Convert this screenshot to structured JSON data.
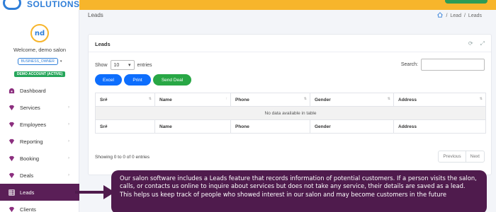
{
  "brand": {
    "name": "SOLUTIONS",
    "logo_mark": "nd"
  },
  "profile": {
    "welcome": "Welcome, demo salon",
    "role": "BUSINESS_OWNER",
    "status": "DEMO ACCOUNT (ACTIVE)"
  },
  "sidebar": {
    "items": [
      {
        "label": "Dashboard",
        "icon": "dashboard-icon"
      },
      {
        "label": "Services",
        "icon": "gem-icon",
        "caret": "›"
      },
      {
        "label": "Employees",
        "icon": "gem-icon",
        "caret": "›"
      },
      {
        "label": "Reporting",
        "icon": "gem-icon",
        "caret": "›"
      },
      {
        "label": "Booking",
        "icon": "gem-icon",
        "caret": "›"
      },
      {
        "label": "Deals",
        "icon": "gem-icon",
        "caret": "›"
      },
      {
        "label": "Leads",
        "icon": "table-icon",
        "active": true
      },
      {
        "label": "Clients",
        "icon": "gem-icon"
      }
    ]
  },
  "header": {
    "title": "Leads",
    "breadcrumb": {
      "current": "Lead",
      "sep": "/"
    }
  },
  "card": {
    "title": "Leads",
    "show_label": "Show",
    "entries_value": "10",
    "entries_label": "entries",
    "search_label": "Search:",
    "buttons": {
      "excel": "Excel",
      "print": "Print",
      "send": "Send Deal"
    },
    "columns": [
      "Sr#",
      "Name",
      "Phone",
      "Gender",
      "Address"
    ],
    "empty_message": "No data available in table",
    "info": "Showing 0 to 0 of 0 entries",
    "pager": {
      "prev": "Previous",
      "next": "Next"
    }
  },
  "callout": {
    "text": "Our salon software includes a Leads feature that records information of potential customers. If a person visits the salon, calls, or contacts us online to inquire about services but does not take any service, their details are saved as a lead. This helps us keep track of people who showed interest in our salon and may become customers in the future"
  },
  "colors": {
    "accent": "#f7b52b",
    "primary": "#0d6efd",
    "success": "#28a745",
    "active_nav": "#5a1f57",
    "callout_bg": "#4f1b4d"
  }
}
